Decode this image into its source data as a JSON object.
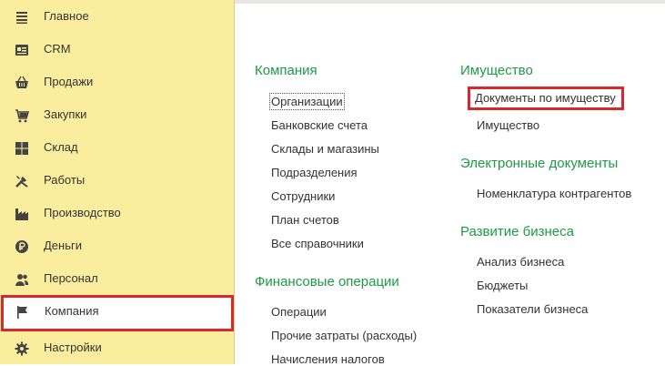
{
  "sidebar": {
    "items": [
      {
        "label": "Главное",
        "icon": "menu-lines-icon"
      },
      {
        "label": "CRM",
        "icon": "crm-icon"
      },
      {
        "label": "Продажи",
        "icon": "basket-icon"
      },
      {
        "label": "Закупки",
        "icon": "cart-icon"
      },
      {
        "label": "Склад",
        "icon": "warehouse-icon"
      },
      {
        "label": "Работы",
        "icon": "tools-icon"
      },
      {
        "label": "Производство",
        "icon": "factory-icon"
      },
      {
        "label": "Деньги",
        "icon": "ruble-coin-icon"
      },
      {
        "label": "Персонал",
        "icon": "people-icon"
      },
      {
        "label": "Компания",
        "icon": "flag-icon",
        "active": true
      },
      {
        "label": "Настройки",
        "icon": "gear-icon"
      }
    ]
  },
  "content": {
    "left": {
      "company": {
        "title": "Компания",
        "links": [
          "Организации",
          "Банковские счета",
          "Склады и магазины",
          "Подразделения",
          "Сотрудники",
          "План счетов",
          "Все справочники"
        ]
      },
      "finance": {
        "title": "Финансовые операции",
        "links": [
          "Операции",
          "Прочие затраты (расходы)",
          "Начисления налогов"
        ]
      }
    },
    "right": {
      "property": {
        "title": "Имущество",
        "links": [
          "Документы по имуществу",
          "Имущество"
        ]
      },
      "edocs": {
        "title": "Электронные документы",
        "links": [
          "Номенклатура контрагентов"
        ]
      },
      "business": {
        "title": "Развитие бизнеса",
        "links": [
          "Анализ бизнеса",
          "Бюджеты",
          "Показатели бизнеса"
        ]
      }
    }
  },
  "colors": {
    "sidebar_bg": "#fbed9e",
    "section_title": "#1e9a46",
    "highlight": "#d9272e"
  }
}
